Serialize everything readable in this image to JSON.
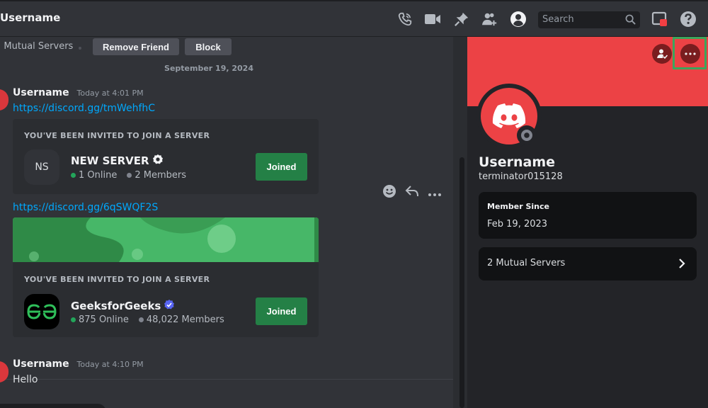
{
  "header": {
    "title": "Username",
    "search_placeholder": "Search",
    "icons": [
      "start-voice-call-icon",
      "start-video-call-icon",
      "pinned-messages-icon",
      "add-friends-to-dm-icon",
      "user-profile-icon",
      "search-icon",
      "inbox-icon",
      "help-icon"
    ]
  },
  "subbar": {
    "mutual_servers": "2 Mutual Servers",
    "remove_friend_label": "Remove Friend",
    "block_label": "Block"
  },
  "chat": {
    "date_divider": "September 19, 2024",
    "messages": [
      {
        "username": "Username",
        "timestamp": "Today at 4:01 PM",
        "link": "https://discord.gg/tmWehfhC",
        "invite": {
          "header": "YOU'VE BEEN INVITED TO JOIN A SERVER",
          "server_initials": "NS",
          "server_name": "NEW SERVER",
          "online": "1 Online",
          "members": "2 Members",
          "button_label": "Joined"
        }
      },
      {
        "link": "https://discord.gg/6qSWQF2S",
        "invite": {
          "header": "YOU'VE BEEN INVITED TO JOIN A SERVER",
          "server_name": "GeeksforGeeks",
          "online": "875 Online",
          "members": "48,022 Members",
          "button_label": "Joined"
        }
      },
      {
        "username": "Username",
        "timestamp": "Today at 4:10 PM",
        "text": "Hello"
      }
    ]
  },
  "profile": {
    "display_name": "Username",
    "handle": "terminator015128",
    "member_since_label": "Member Since",
    "member_since_value": "Feb 19, 2023",
    "mutual_servers_label": "2 Mutual Servers"
  },
  "colors": {
    "background": "#313338",
    "panel": "#232428",
    "banner": "#ec4245",
    "accent_green": "#248046",
    "link": "#00a8fc",
    "highlight": "#3ba55c"
  }
}
